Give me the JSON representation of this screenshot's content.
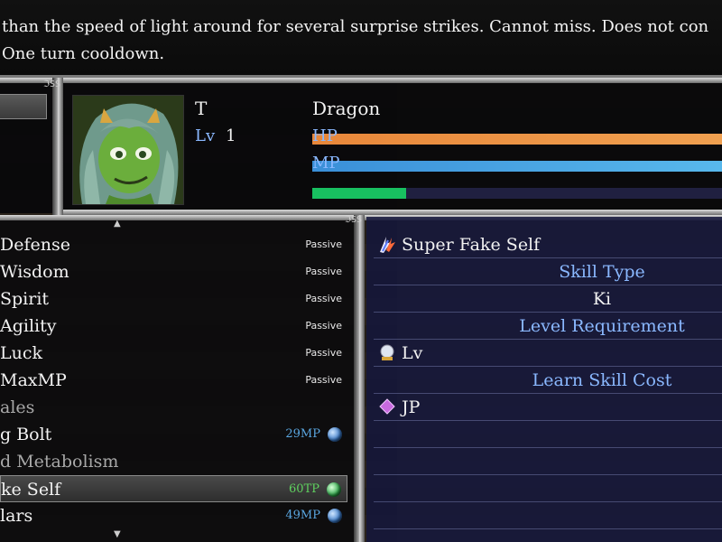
{
  "help": {
    "line1": "than the speed of light around for several surprise strikes. Cannot miss. Does not con",
    "line2": "One turn cooldown."
  },
  "corner_marks": [
    "ℑSS",
    "ℑSS"
  ],
  "actor": {
    "name": "T",
    "level_label": "Lv",
    "level": "1",
    "class": "Dragon",
    "hp_label": "HP",
    "mp_label": "MP",
    "hp_fill": 1.0,
    "mp_fill": 1.0,
    "tp_fill": 0.23,
    "colors": {
      "hp": "#e8873a",
      "mp": "#3a8fd8",
      "tp": "#18c060"
    }
  },
  "skills": [
    {
      "name": "Defense",
      "cost": "Passive",
      "cost_type": "passive"
    },
    {
      "name": "Wisdom",
      "cost": "Passive",
      "cost_type": "passive"
    },
    {
      "name": "Spirit",
      "cost": "Passive",
      "cost_type": "passive"
    },
    {
      "name": "Agility",
      "cost": "Passive",
      "cost_type": "passive"
    },
    {
      "name": "Luck",
      "cost": "Passive",
      "cost_type": "passive"
    },
    {
      "name": "MaxMP",
      "cost": "Passive",
      "cost_type": "passive"
    },
    {
      "name": "ales",
      "cost": "",
      "cost_type": "none"
    },
    {
      "name": "g Bolt",
      "cost": "29MP",
      "cost_type": "mp"
    },
    {
      "name": "d Metabolism",
      "cost": "",
      "cost_type": "none"
    },
    {
      "name": "ke Self",
      "cost": "60TP",
      "cost_type": "tp",
      "selected": true
    },
    {
      "name": "lars",
      "cost": "49MP",
      "cost_type": "mp"
    }
  ],
  "detail": {
    "skill_name": "Super Fake Self",
    "skill_icon": "lightning-wing-icon",
    "skill_type_label": "Skill Type",
    "skill_type_value": "Ki",
    "level_req_label": "Level Requirement",
    "level_req_value": "Lv",
    "level_req_icon": "crystal-ball-icon",
    "learn_cost_label": "Learn Skill Cost",
    "learn_cost_value": "JP",
    "learn_cost_icon": "purple-diamond-icon"
  }
}
